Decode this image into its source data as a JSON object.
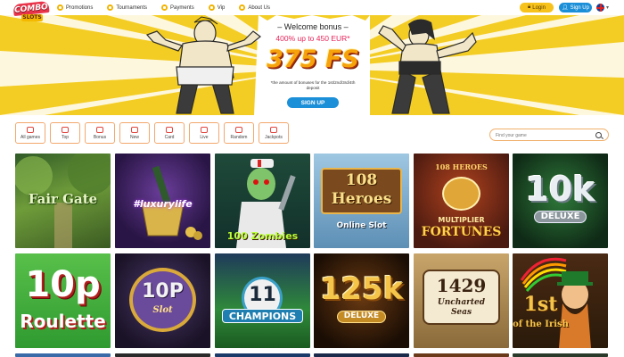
{
  "header": {
    "logo": {
      "top": "COMBO",
      "bottom": "SLOTS"
    },
    "nav": [
      {
        "label": "Promotions"
      },
      {
        "label": "Tournaments"
      },
      {
        "label": "Payments"
      },
      {
        "label": "Vip"
      },
      {
        "label": "About Us"
      }
    ],
    "login_label": "Login",
    "signup_label": "Sign Up",
    "language_icon": "uk-flag-icon"
  },
  "banner": {
    "title": "– Welcome bonus –",
    "subtitle": "400% up to 450 EUR*",
    "free_spins": "375 FS",
    "note": "*the amount of bonuses for the 1st/2nd/3rd/4th deposit",
    "signup_label": "SIGN UP"
  },
  "categories": [
    {
      "label": "All games",
      "icon": "thumbs-up-icon"
    },
    {
      "label": "Top",
      "icon": "crown-icon"
    },
    {
      "label": "Bonus",
      "icon": "gift-icon"
    },
    {
      "label": "New",
      "icon": "star-icon"
    },
    {
      "label": "Card",
      "icon": "card-icon"
    },
    {
      "label": "Live",
      "icon": "live-icon"
    },
    {
      "label": "Random",
      "icon": "shuffle-icon"
    },
    {
      "label": "Jackpots",
      "icon": "coin-icon"
    }
  ],
  "search": {
    "placeholder": "Find your game"
  },
  "games": [
    {
      "title": "Fair Gate"
    },
    {
      "title": "#luxurylife"
    },
    {
      "title": "100 Zombies"
    },
    {
      "title": "108 Heroes",
      "subtitle": "Online Slot"
    },
    {
      "title": "108 Heroes Multiplier Fortunes",
      "top": "108 HEROES",
      "line1": "MULTIPLIER",
      "line2": "FORTUNES"
    },
    {
      "title": "10k",
      "subtitle": "DELUXE"
    },
    {
      "title": "10p",
      "subtitle": "Roulette"
    },
    {
      "title": "10P",
      "subtitle": "Slot"
    },
    {
      "title": "11",
      "subtitle": "CHAMPIONS"
    },
    {
      "title": "125k",
      "subtitle": "DELUXE"
    },
    {
      "title": "1429",
      "subtitle": "Uncharted Seas"
    },
    {
      "title": "1st",
      "subtitle": "of the Irish"
    }
  ]
}
